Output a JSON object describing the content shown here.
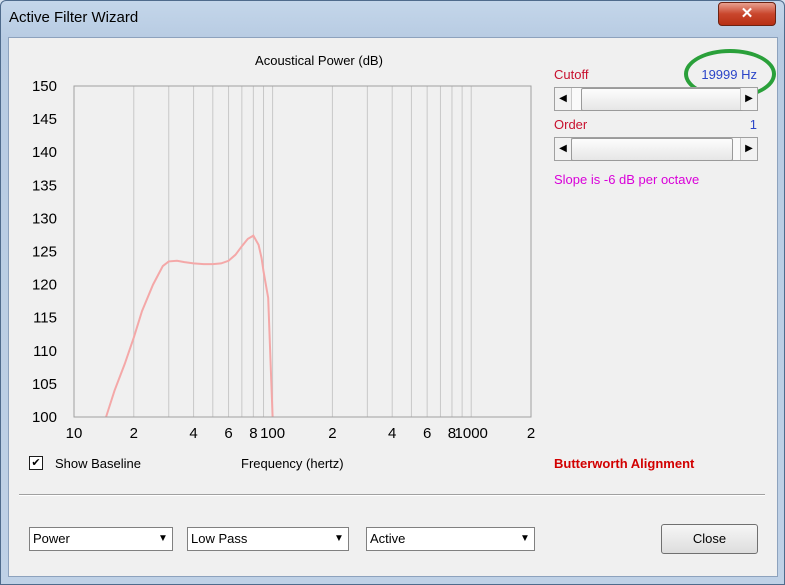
{
  "window": {
    "title": "Active Filter Wizard",
    "close_glyph": "✕"
  },
  "chart_data": {
    "type": "line",
    "title": "Acoustical Power (dB)",
    "xlabel": "Frequency (hertz)",
    "ylabel": "",
    "x_scale": "log",
    "xlim": [
      10,
      2000
    ],
    "ylim": [
      100,
      150
    ],
    "yticks": [
      "150",
      "145",
      "140",
      "135",
      "130",
      "125",
      "120",
      "115",
      "110",
      "105",
      "100"
    ],
    "xticks": [
      "10",
      "2",
      "4",
      "6",
      "8",
      "100",
      "2",
      "4",
      "6",
      "8",
      "1000",
      "2"
    ],
    "grid": true,
    "series": [
      {
        "color": "#f4a8a8",
        "x": [
          14.5,
          16,
          18,
          20,
          22,
          25,
          28,
          30,
          33,
          36,
          40,
          45,
          50,
          55,
          60,
          65,
          70,
          75,
          80,
          85,
          88,
          90,
          95,
          100
        ],
        "y": [
          100,
          104,
          108,
          112,
          116,
          120,
          122.8,
          123.5,
          123.6,
          123.4,
          123.2,
          123.1,
          123.1,
          123.2,
          123.6,
          124.5,
          125.8,
          126.9,
          127.4,
          126,
          124,
          122,
          118,
          100
        ]
      }
    ]
  },
  "controls": {
    "cutoff_label": "Cutoff",
    "cutoff_value": "19999 Hz",
    "cutoff_fraction": 0.99,
    "order_label": "Order",
    "order_value": "1",
    "order_fraction": 0.0,
    "slope_text": "Slope is -6 dB per octave",
    "left_arrow_glyph": "◀",
    "right_arrow_glyph": "▶"
  },
  "bottom": {
    "show_baseline_label": "Show Baseline",
    "show_baseline_checked": true,
    "check_glyph": "✔",
    "alignment_text": "Butterworth Alignment",
    "dropdown_glyph": "▼",
    "combo_mode": "Power",
    "combo_filter": "Low Pass",
    "combo_type": "Active",
    "close_label": "Close"
  },
  "colors": {
    "cutoff_label": "#c8102e",
    "value_blue": "#2b45c8",
    "slope_magenta": "#d900d9",
    "alignment_red": "#d20000",
    "annotation_green": "#2aa03a",
    "curve": "#f4a8a8"
  }
}
